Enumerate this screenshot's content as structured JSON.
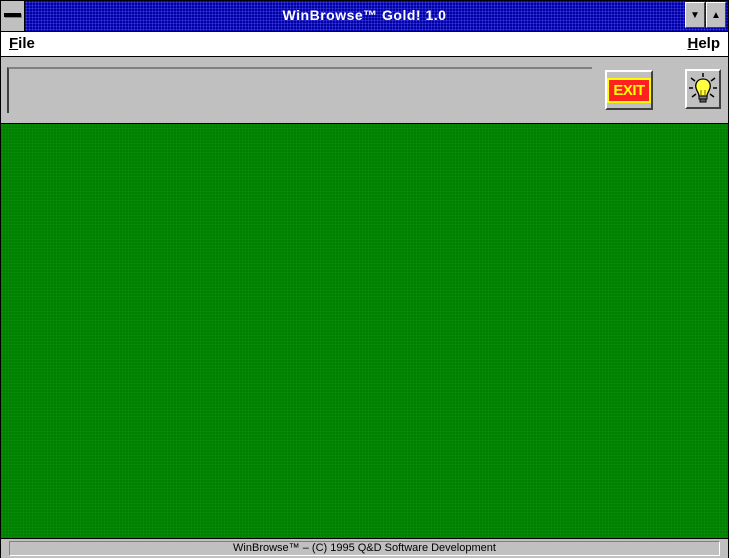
{
  "window": {
    "title": "WinBrowse™ Gold! 1.0"
  },
  "titlebar": {
    "system_menu_icon": "system-menu-bar",
    "minimize_icon": "triangle-down",
    "maximize_icon": "triangle-up"
  },
  "menubar": {
    "file_label_first": "F",
    "file_label_rest": "ile",
    "help_label_first": "H",
    "help_label_rest": "elp"
  },
  "toolbar": {
    "address_value": "",
    "exit_label": "EXIT",
    "help_icon": "lightbulb-icon"
  },
  "colors": {
    "title_bar": "#0000a8",
    "content_background": "#008000",
    "chrome": "#c0c0c0",
    "exit_background": "#ff2020",
    "exit_text": "#ffff00"
  },
  "status": {
    "text": "WinBrowse™ – (C) 1995 Q&D Software Development"
  }
}
